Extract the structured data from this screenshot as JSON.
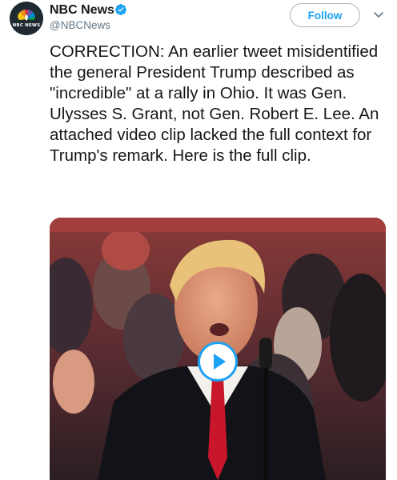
{
  "account": {
    "display_name": "NBC News",
    "handle": "@NBCNews",
    "avatar_text": "NBC NEWS",
    "verified": true
  },
  "actions": {
    "follow_label": "Follow"
  },
  "tweet": {
    "text": "CORRECTION: An earlier tweet misidentified the general President Trump described as \"incredible\" at a rally in Ohio. It was Gen. Ulysses S. Grant, not Gen. Robert E. Lee. An attached video clip lacked the full context for Trump's remark. Here is the full clip."
  },
  "media": {
    "type": "video",
    "icon": "play-icon"
  },
  "colors": {
    "accent": "#1da1f2",
    "text": "#14171a",
    "secondary": "#657786"
  }
}
